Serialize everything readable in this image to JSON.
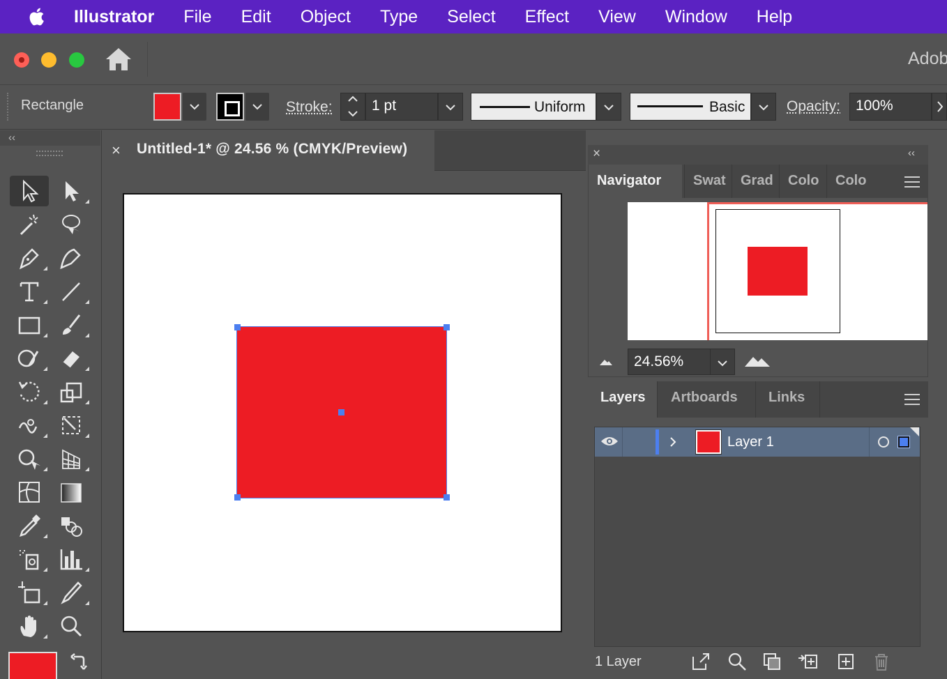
{
  "menubar": {
    "app_name": "Illustrator",
    "items": [
      "File",
      "Edit",
      "Object",
      "Type",
      "Select",
      "Effect",
      "View",
      "Window",
      "Help"
    ]
  },
  "titlebar": {
    "app_label": "Adob"
  },
  "control_bar": {
    "tool_name": "Rectangle",
    "stroke_label": "Stroke:",
    "stroke_weight": "1 pt",
    "variable_width_profile": "Uniform",
    "brush_definition": "Basic",
    "opacity_label": "Opacity:",
    "opacity_value": "100%"
  },
  "document": {
    "tab_close": "×",
    "tab_title": "Untitled-1* @ 24.56 % (CMYK/Preview)"
  },
  "toolbar": {
    "collapse": "‹‹"
  },
  "panels": {
    "close": "×",
    "collapse": "‹‹",
    "top_tabs": [
      "Navigator",
      "Swat",
      "Grad",
      "Colo",
      "Colo"
    ],
    "zoom_value": "24.56%",
    "layer_tabs": [
      "Layers",
      "Artboards",
      "Links"
    ],
    "layers": [
      {
        "name": "Layer 1"
      }
    ],
    "layers_count": "1 Layer"
  },
  "colors": {
    "fill": "#ed1c24",
    "selection": "#4c7ff0",
    "menubar_bg": "#5b22c2"
  }
}
